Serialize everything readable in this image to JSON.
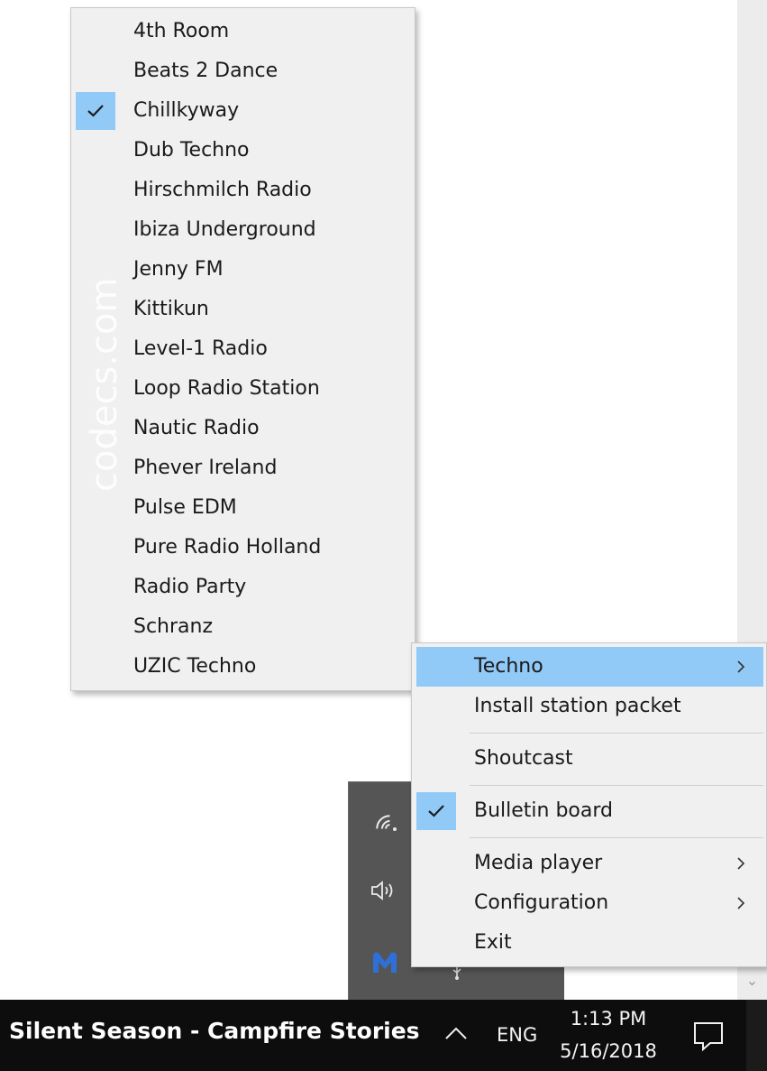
{
  "station_menu": {
    "items": [
      {
        "label": "4th Room",
        "checked": false
      },
      {
        "label": "Beats 2 Dance",
        "checked": false
      },
      {
        "label": "Chillkyway",
        "checked": true
      },
      {
        "label": "Dub Techno",
        "checked": false
      },
      {
        "label": "Hirschmilch Radio",
        "checked": false
      },
      {
        "label": "Ibiza Underground",
        "checked": false
      },
      {
        "label": "Jenny FM",
        "checked": false
      },
      {
        "label": "Kittikun",
        "checked": false
      },
      {
        "label": "Level-1 Radio",
        "checked": false
      },
      {
        "label": "Loop Radio Station",
        "checked": false
      },
      {
        "label": "Nautic Radio",
        "checked": false
      },
      {
        "label": "Phever Ireland",
        "checked": false
      },
      {
        "label": "Pulse EDM",
        "checked": false
      },
      {
        "label": "Pure Radio Holland",
        "checked": false
      },
      {
        "label": "Radio Party",
        "checked": false
      },
      {
        "label": "Schranz",
        "checked": false
      },
      {
        "label": "UZIC Techno",
        "checked": false
      }
    ],
    "watermark": "codecs.com"
  },
  "main_menu": {
    "techno": "Techno",
    "install_station_packet": "Install station packet",
    "shoutcast": "Shoutcast",
    "bulletin_board": "Bulletin board",
    "media_player": "Media player",
    "configuration": "Configuration",
    "exit": "Exit"
  },
  "tray_icons": [
    "wifi-icon",
    "volume-icon",
    "malwarebytes-icon",
    "usb-icon"
  ],
  "taskbar": {
    "now_playing": "Silent Season - Campfire Stories",
    "language": "ENG",
    "time": "1:13 PM",
    "date": "5/16/2018"
  },
  "colors": {
    "menu_bg": "#f0f0f0",
    "highlight": "#91c9f7",
    "taskbar": "#0d0d0d",
    "tray_flyout": "#555555",
    "malwarebytes": "#2f6fd8"
  }
}
